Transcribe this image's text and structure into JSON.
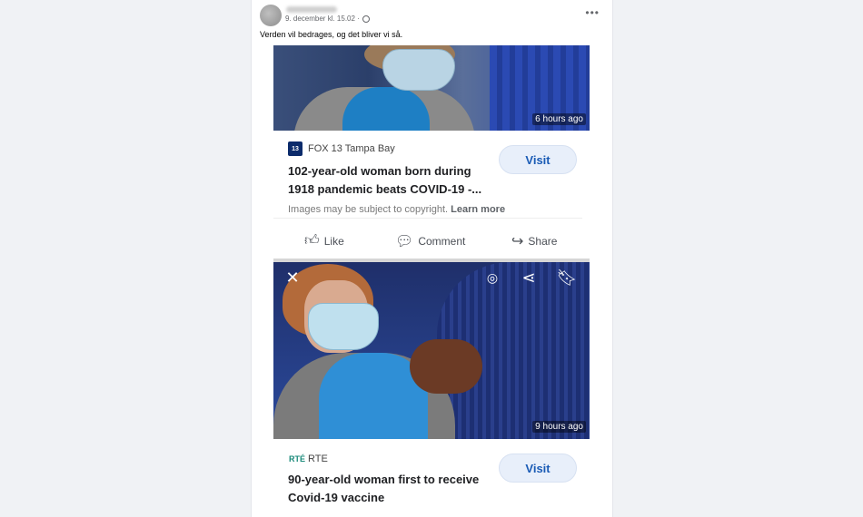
{
  "post": {
    "meta": "9. december kl. 15.02 ·",
    "text": "Verden vil bedrages, og det bliver vi så.",
    "more_icon": "more-horizontal-icon"
  },
  "results": [
    {
      "time": "6 hours ago",
      "source_logo": "13",
      "source": "FOX 13 Tampa Bay",
      "headline_line1": "102-year-old woman born during",
      "headline_line2": "1918 pandemic beats COVID-19 -...",
      "visit_label": "Visit",
      "copyright": "Images may be subject to copyright.",
      "learn_more": "Learn more"
    },
    {
      "time": "9 hours ago",
      "source_logo": "RTÉ",
      "source": "RTE",
      "headline_line1": "90-year-old woman first to receive",
      "headline_line2": "Covid-19 vaccine",
      "visit_label": "Visit"
    }
  ],
  "actions": {
    "like": "Like",
    "comment": "Comment",
    "share": "Share"
  },
  "colors": {
    "visit_text": "#1a5bb5",
    "visit_bg": "#e8effa",
    "fox_logo_bg": "#0c2b6b"
  }
}
